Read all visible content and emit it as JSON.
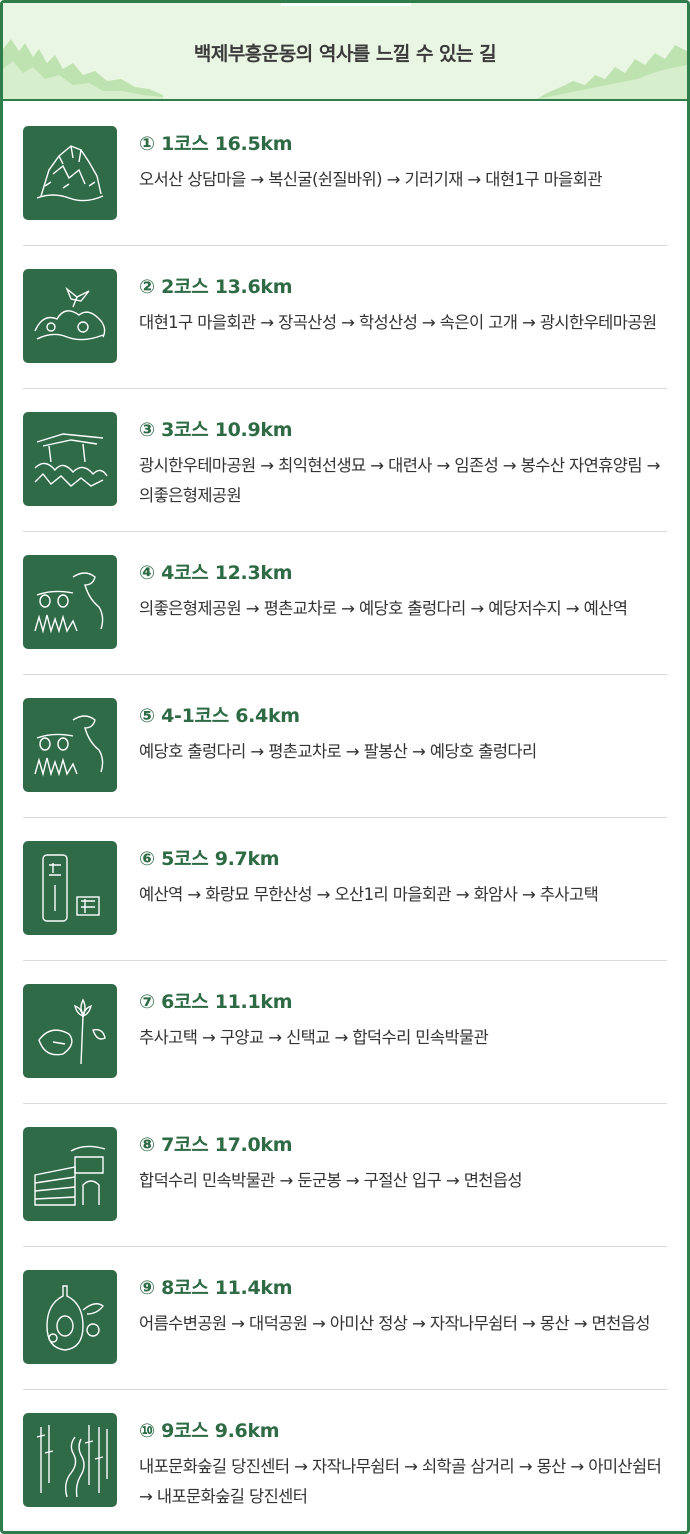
{
  "header": {
    "title": "백제부흥운동의 역사를 느낄 수 있는 길"
  },
  "courses": [
    {
      "title": "① 1코스 16.5km",
      "route": "오서산 상담마을 → 복신굴(쉰질바위) → 기러기재 → 대현1구 마을회관",
      "icon": "rock-mountain-icon"
    },
    {
      "title": "② 2코스 13.6km",
      "route": "대현1구 마을회관 → 장곡산성 → 학성산성 → 속은이 고개 → 광시한우테마공원",
      "icon": "crane-over-hills-icon"
    },
    {
      "title": "③ 3코스 10.9km",
      "route": "광시한우테마공원 → 최익현선생묘 → 대련사 → 임존성 → 봉수산 자연휴양림 →의좋은형제공원",
      "icon": "temple-forest-icon"
    },
    {
      "title": "④ 4코스 12.3km",
      "route": "의좋은형제공원 → 평촌교차로 → 예당호 출렁다리 → 예당저수지 → 예산역",
      "icon": "dinosaur-lanterns-icon"
    },
    {
      "title": "⑤ 4-1코스 6.4km",
      "route": "예당호 출렁다리 → 평촌교차로 → 팔봉산 → 예당호 출렁다리",
      "icon": "dinosaur-lanterns-icon"
    },
    {
      "title": "⑥ 5코스 9.7km",
      "route": "예산역 → 화랑묘 무한산성 → 오산1리 마을회관 → 화암사 → 추사고택",
      "icon": "stone-stele-seal-icon"
    },
    {
      "title": "⑦ 6코스 11.1km",
      "route": "추사고택 → 구양교 → 신택교 → 합덕수리 민속박물관",
      "icon": "lotus-flower-icon"
    },
    {
      "title": "⑧ 7코스 17.0km",
      "route": "합덕수리 민속박물관 → 둔군봉 → 구절산 입구 → 면천읍성",
      "icon": "fortress-gate-icon"
    },
    {
      "title": "⑨ 8코스 11.4km",
      "route": "어름수변공원 → 대덕공원 → 아미산 정상 → 자작나무쉼터 → 몽산 → 면천읍성",
      "icon": "wine-jar-flowers-icon"
    },
    {
      "title": "⑩ 9코스 9.6km",
      "route": "내포문화숲길 당진센터 → 자작나무쉼터 → 쇠학골 삼거리 → 몽산 → 아미산쉼터 → 내포문화숲길 당진센터",
      "icon": "birch-forest-path-icon"
    }
  ],
  "colors": {
    "accent": "#2e7d4a",
    "header_bg": "#eaf6e4",
    "thumb_bg": "#2f6b47",
    "title_text": "#2e6b45"
  }
}
